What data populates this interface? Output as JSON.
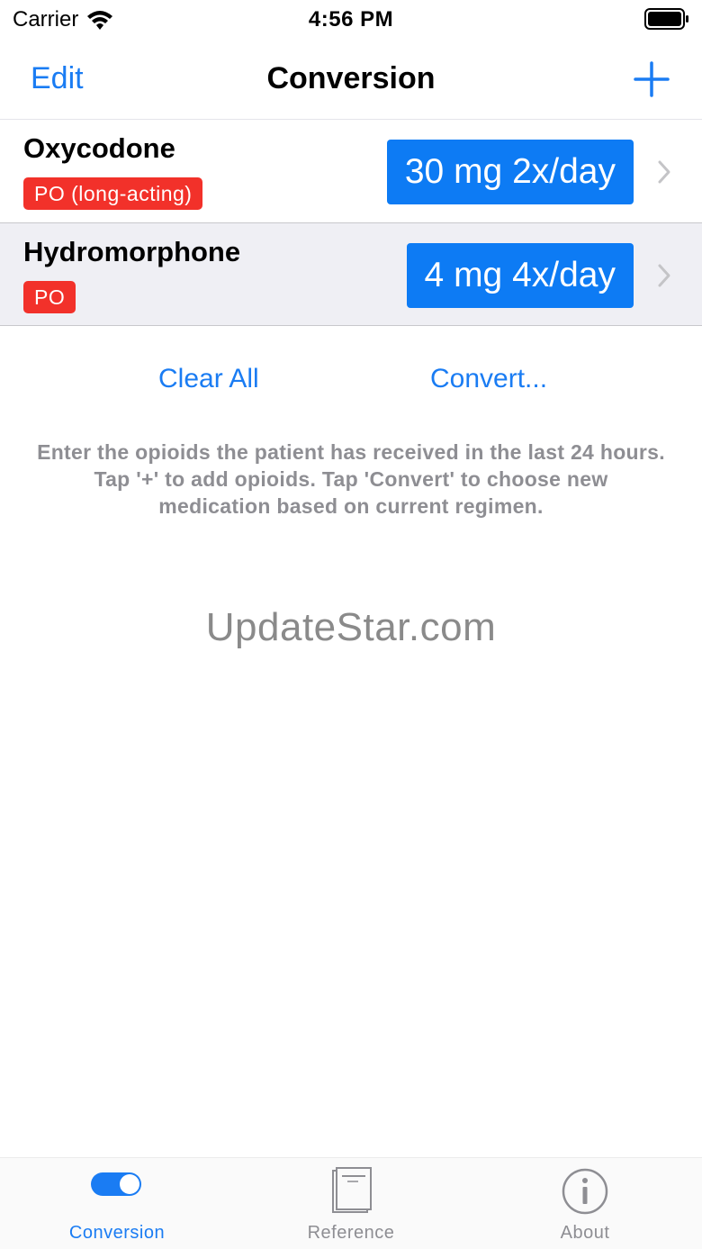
{
  "status": {
    "carrier": "Carrier",
    "time": "4:56 PM"
  },
  "nav": {
    "edit": "Edit",
    "title": "Conversion"
  },
  "medications": [
    {
      "name": "Oxycodone",
      "route": "PO (long-acting)",
      "dose": "30 mg 2x/day"
    },
    {
      "name": "Hydromorphone",
      "route": "PO",
      "dose": "4 mg 4x/day"
    }
  ],
  "actions": {
    "clear_all": "Clear All",
    "convert": "Convert..."
  },
  "hint": "Enter the opioids the patient has received in the last 24 hours. Tap '+' to add opioids. Tap 'Convert' to choose new medication based on current regimen.",
  "watermark": "UpdateStar.com",
  "tabs": [
    {
      "label": "Conversion",
      "icon": "toggle-icon",
      "active": true
    },
    {
      "label": "Reference",
      "icon": "book-icon",
      "active": false
    },
    {
      "label": "About",
      "icon": "info-icon",
      "active": false
    }
  ],
  "colors": {
    "accent": "#1a7cf3",
    "dose_button": "#0d7bf4",
    "badge": "#f2312a",
    "selected_row": "#efeff4"
  }
}
